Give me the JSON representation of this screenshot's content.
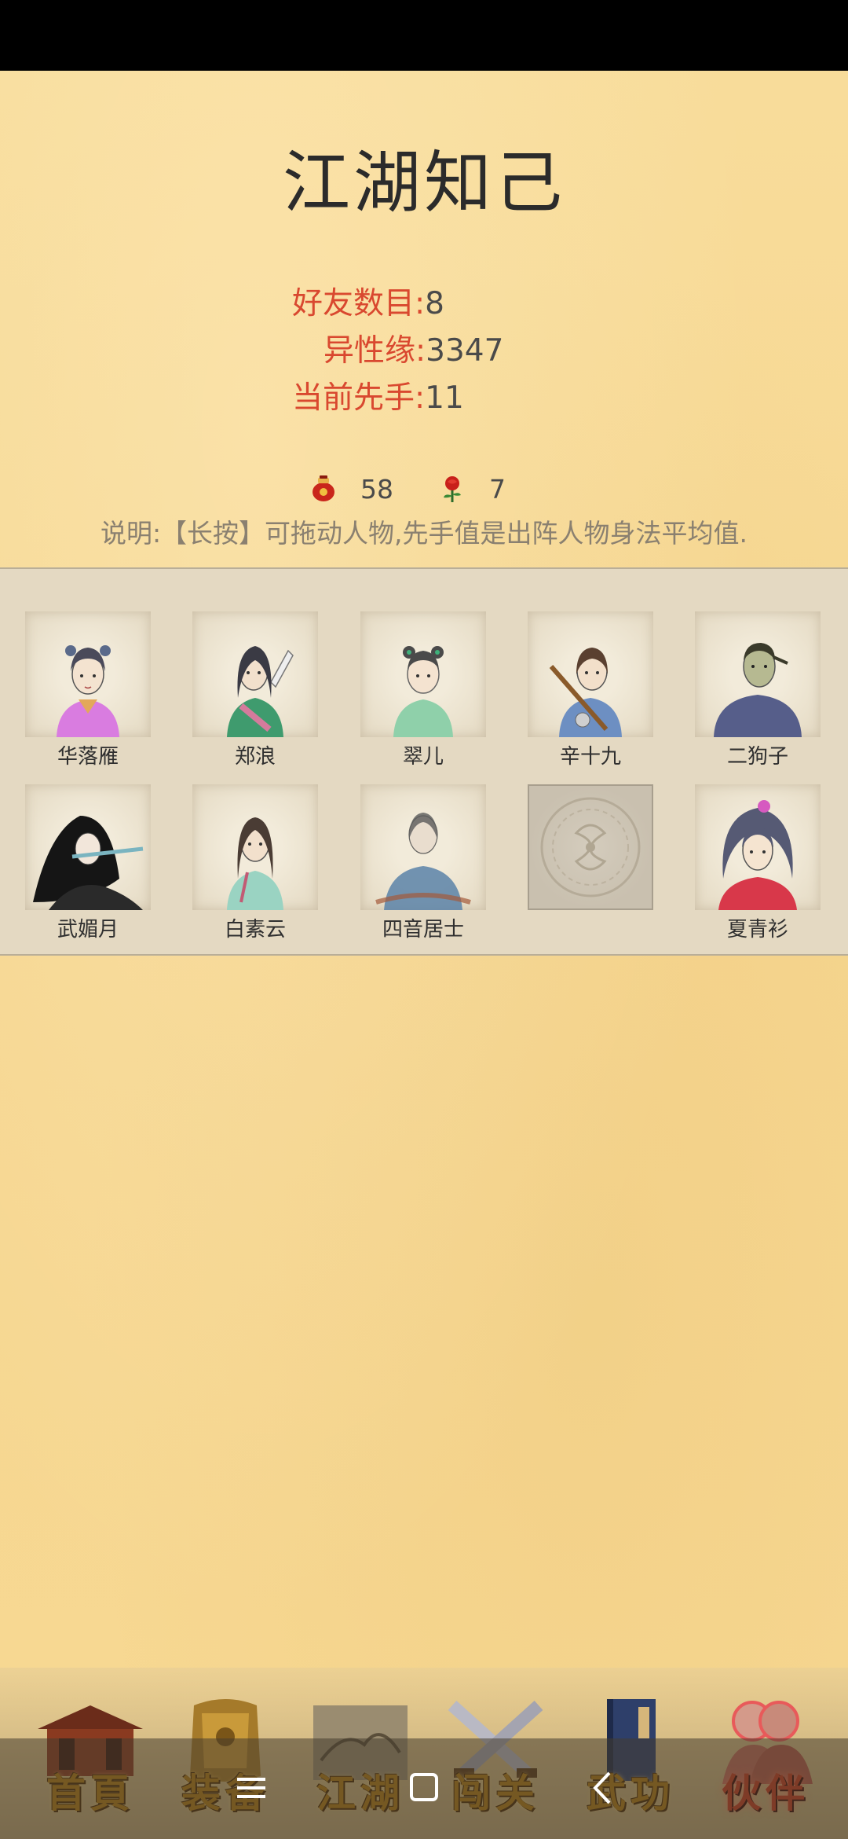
{
  "page": {
    "title": "江湖知己"
  },
  "stats": [
    {
      "label": "好友数目:",
      "value": "8"
    },
    {
      "label": "异性缘:",
      "value": "3347"
    },
    {
      "label": "当前先手:",
      "value": "11"
    }
  ],
  "currencies": [
    {
      "icon": "wine-jar-icon",
      "value": "58"
    },
    {
      "icon": "rose-icon",
      "value": "7"
    }
  ],
  "description": "说明:【长按】可拖动人物,先手值是出阵人物身法平均值.",
  "characters": [
    {
      "name": "华落雁"
    },
    {
      "name": "郑浪"
    },
    {
      "name": "翠儿"
    },
    {
      "name": "辛十九"
    },
    {
      "name": "二狗子"
    },
    {
      "name": "武媚月"
    },
    {
      "name": "白素云"
    },
    {
      "name": "四音居士"
    },
    {
      "name": ""
    },
    {
      "name": "夏青衫"
    }
  ],
  "bottom_nav": [
    {
      "label": "首頁",
      "icon": "house-icon"
    },
    {
      "label": "装备",
      "icon": "armor-icon"
    },
    {
      "label": "江湖",
      "icon": "scroll-map-icon"
    },
    {
      "label": "闯关",
      "icon": "crossed-swords-icon"
    },
    {
      "label": "武功",
      "icon": "manual-book-icon"
    },
    {
      "label": "伙伴",
      "icon": "companions-icon",
      "active": true
    }
  ],
  "system_nav": [
    "menu-icon",
    "home-square-icon",
    "back-chevron-icon"
  ],
  "colors": {
    "accent_label": "#d9482f",
    "parchment": "#f7d890",
    "roster_bg": "#e4d9c2",
    "nav_gold": "#b07a16",
    "nav_active": "#c43b20"
  }
}
